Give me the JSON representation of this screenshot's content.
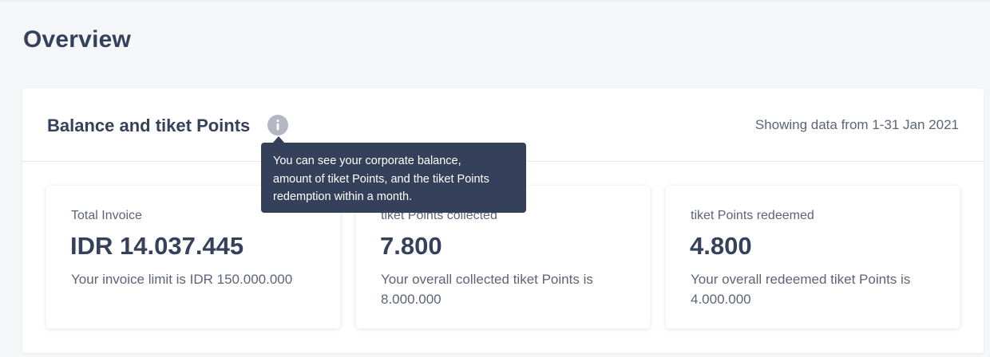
{
  "page": {
    "title": "Overview"
  },
  "panel": {
    "title": "Balance and tiket Points",
    "info_icon": "info-icon",
    "date_range": "Showing data from 1-31 Jan 2021"
  },
  "tooltip": {
    "line1": "You can see your corporate balance,",
    "line2": "amount of tiket Points, and the tiket Points",
    "line3": "redemption within a month."
  },
  "cards": [
    {
      "label": "Total Invoice",
      "value": "IDR 14.037.445",
      "note": "Your invoice limit is IDR 150.000.000"
    },
    {
      "label": "tiket Points collected",
      "value": "7.800",
      "note": "Your overall collected tiket Points is 8.000.000"
    },
    {
      "label": "tiket Points redeemed",
      "value": "4.800",
      "note": "Your overall redeemed tiket Points is 4.000.000"
    }
  ],
  "colors": {
    "text_primary": "#35405a",
    "text_secondary": "#5b6478",
    "tooltip_bg": "#35405a",
    "info_icon": "#b3b8c3",
    "background": "#f5f6f8"
  }
}
